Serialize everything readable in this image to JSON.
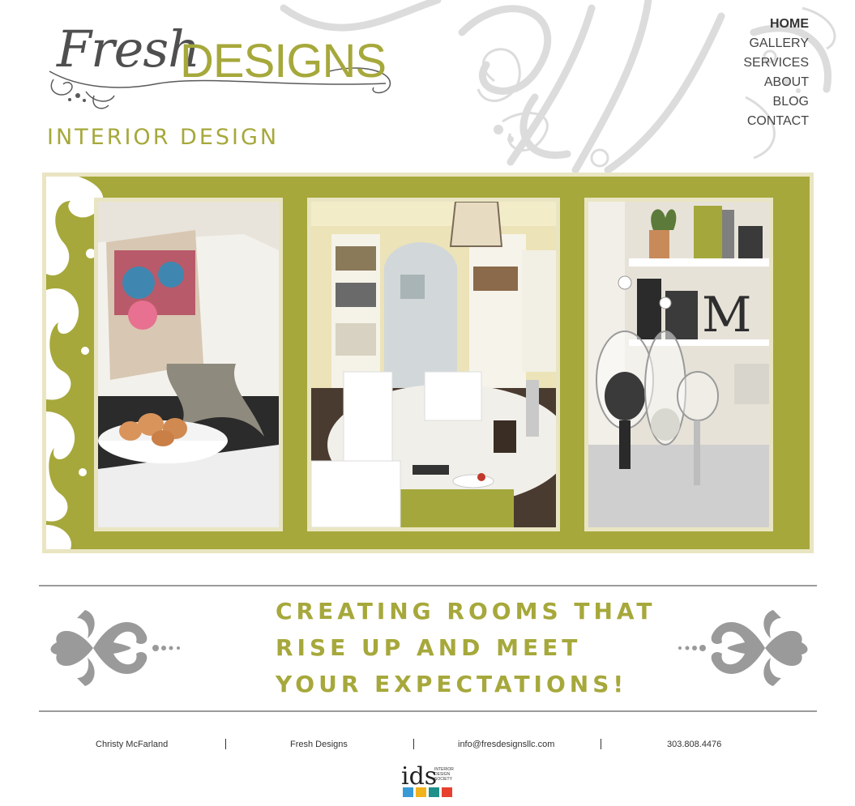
{
  "logo": {
    "script_text": "Fresh",
    "brand_text": "DESIGNS"
  },
  "tagline": "INTERIOR DESIGN",
  "nav": {
    "items": [
      {
        "label": "HOME",
        "active": true
      },
      {
        "label": "GALLERY",
        "active": false
      },
      {
        "label": "SERVICES",
        "active": false
      },
      {
        "label": "ABOUT",
        "active": false
      },
      {
        "label": "BLOG",
        "active": false
      },
      {
        "label": "CONTACT",
        "active": false
      }
    ]
  },
  "slogan": {
    "lines": [
      "CREATING ROOMS THAT",
      "RISE UP AND MEET",
      "YOUR EXPECTATIONS!"
    ]
  },
  "footer": {
    "name": "Christy McFarland",
    "company": "Fresh Designs",
    "email": "info@fresdesignsllc.com",
    "phone": "303.808.4476"
  },
  "badge": {
    "letters": "ids",
    "text_lines": [
      "INTERIOR",
      "DESIGN",
      "SOCIETY"
    ],
    "colors": [
      "#3a9ad6",
      "#f2b21b",
      "#1f8f8a",
      "#e8402e"
    ]
  },
  "colors": {
    "accent": "#a6a83b",
    "frame": "#e9e5c2",
    "ornament": "#9a9a9a",
    "swirl": "#dcdcdc"
  }
}
